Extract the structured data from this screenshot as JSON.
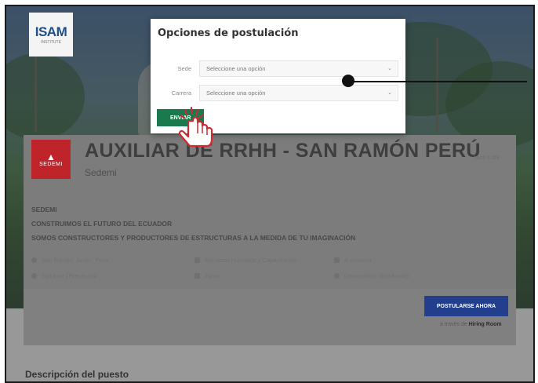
{
  "brand": {
    "logo_text": "ISAM",
    "logo_subtext": "INSTITUTE"
  },
  "modal": {
    "title": "Opciones de postulación",
    "fields": [
      {
        "label": "Sede",
        "placeholder": "Seleccione una opción"
      },
      {
        "label": "Carrera",
        "placeholder": "Seleccione una opción"
      }
    ],
    "submit_label": "ENVIAR"
  },
  "job": {
    "title": "AUXILIAR DE RRHH - SAN RAMÓN PERÚ",
    "company": "Sedemi",
    "company_logo_text": "SEDEMI",
    "posted": "hace 1 día",
    "description_lines": [
      "SEDEMI",
      "CONSTRUIMOS EL FUTURO DEL ECUADOR",
      "SOMOS CONSTRUCTORES Y PRODUCTORES DE ESTRUCTURAS A LA MEDIDA DE TU IMAGINACIÓN"
    ],
    "meta": {
      "location": "San Ramón, Junín - Peru",
      "area": "Recursos Humanos y Capacitación",
      "salary": "A convenir",
      "schedule": "Full-time | Presencial",
      "level": "Junior",
      "education": "Universitario (Graduado)"
    },
    "apply_label": "POSTULARSE AHORA",
    "via_prefix": "a través de",
    "via_name": "Hiring Room"
  },
  "section": {
    "description_title": "Descripción del puesto"
  },
  "colors": {
    "modal_button": "#1a7a4e",
    "apply_button": "#233e8d",
    "company_logo": "#c0242b"
  }
}
